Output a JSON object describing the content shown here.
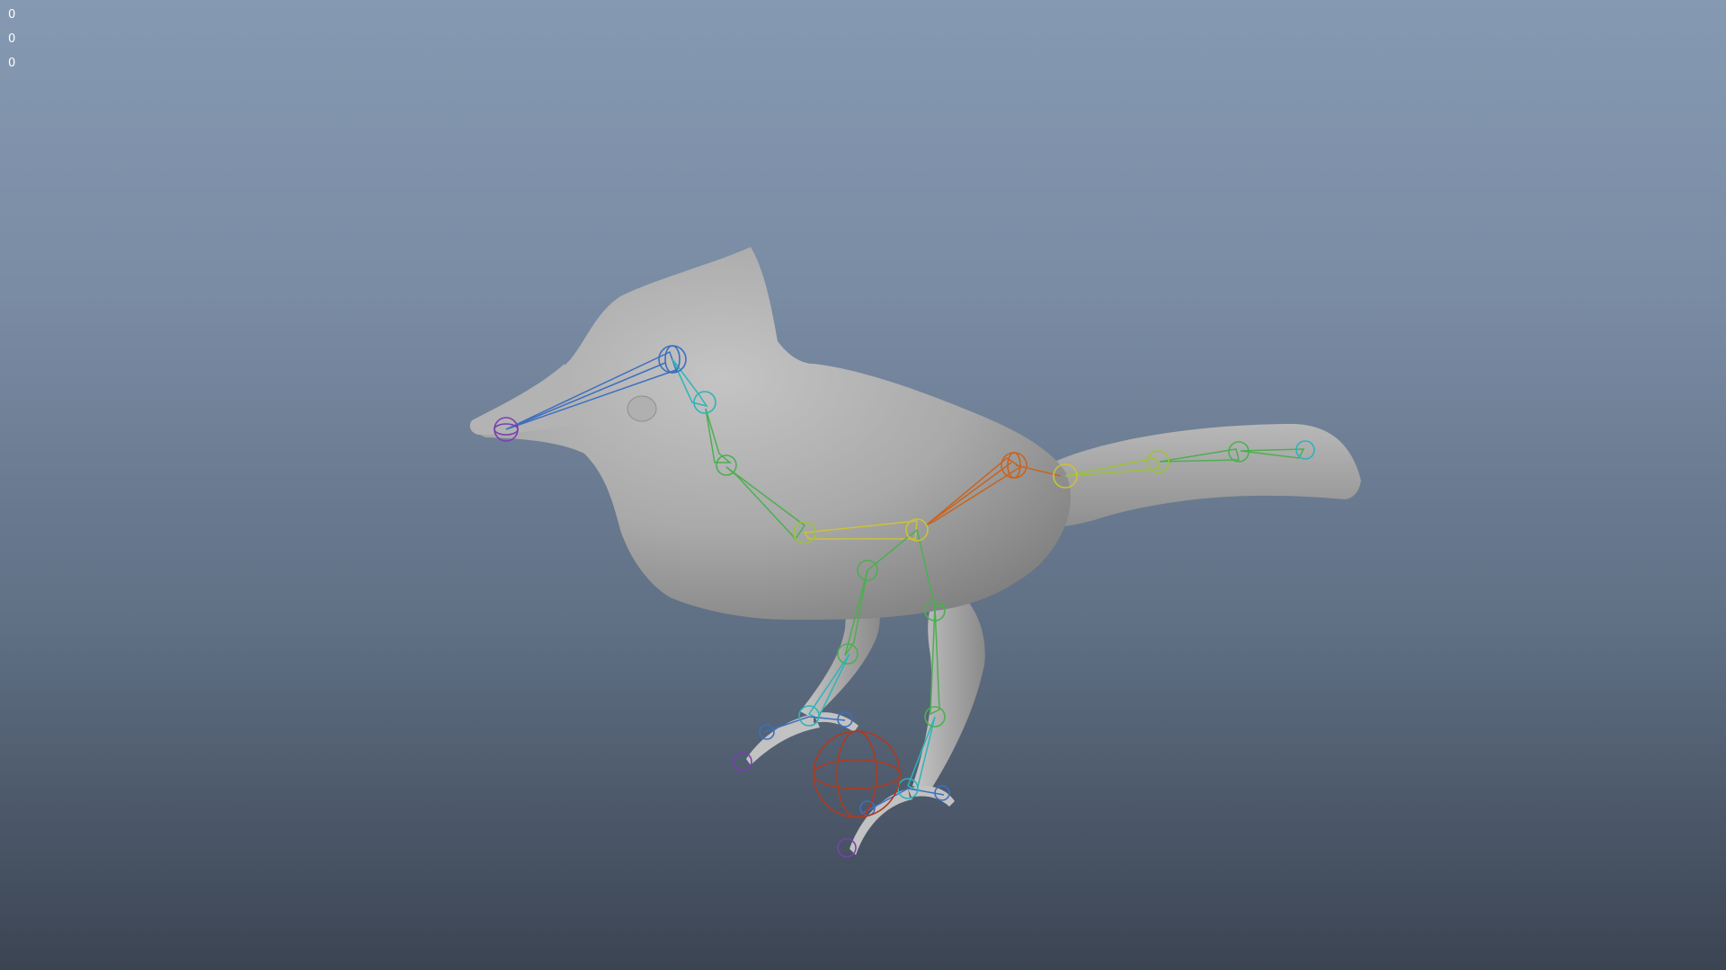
{
  "viewport": {
    "hud_counters": [
      "0",
      "0",
      "0"
    ]
  },
  "scene": {
    "model": "bird",
    "rig_colors": {
      "purple": "#7a3fb0",
      "blue": "#3d6fbf",
      "cyan": "#2db4b9",
      "green": "#4caf50",
      "lime": "#9cc23a",
      "yellow": "#c9c23a",
      "orange": "#c8641e",
      "red": "#b03a1e"
    },
    "background_top": "#8599b2",
    "background_bottom": "#3b4452"
  }
}
